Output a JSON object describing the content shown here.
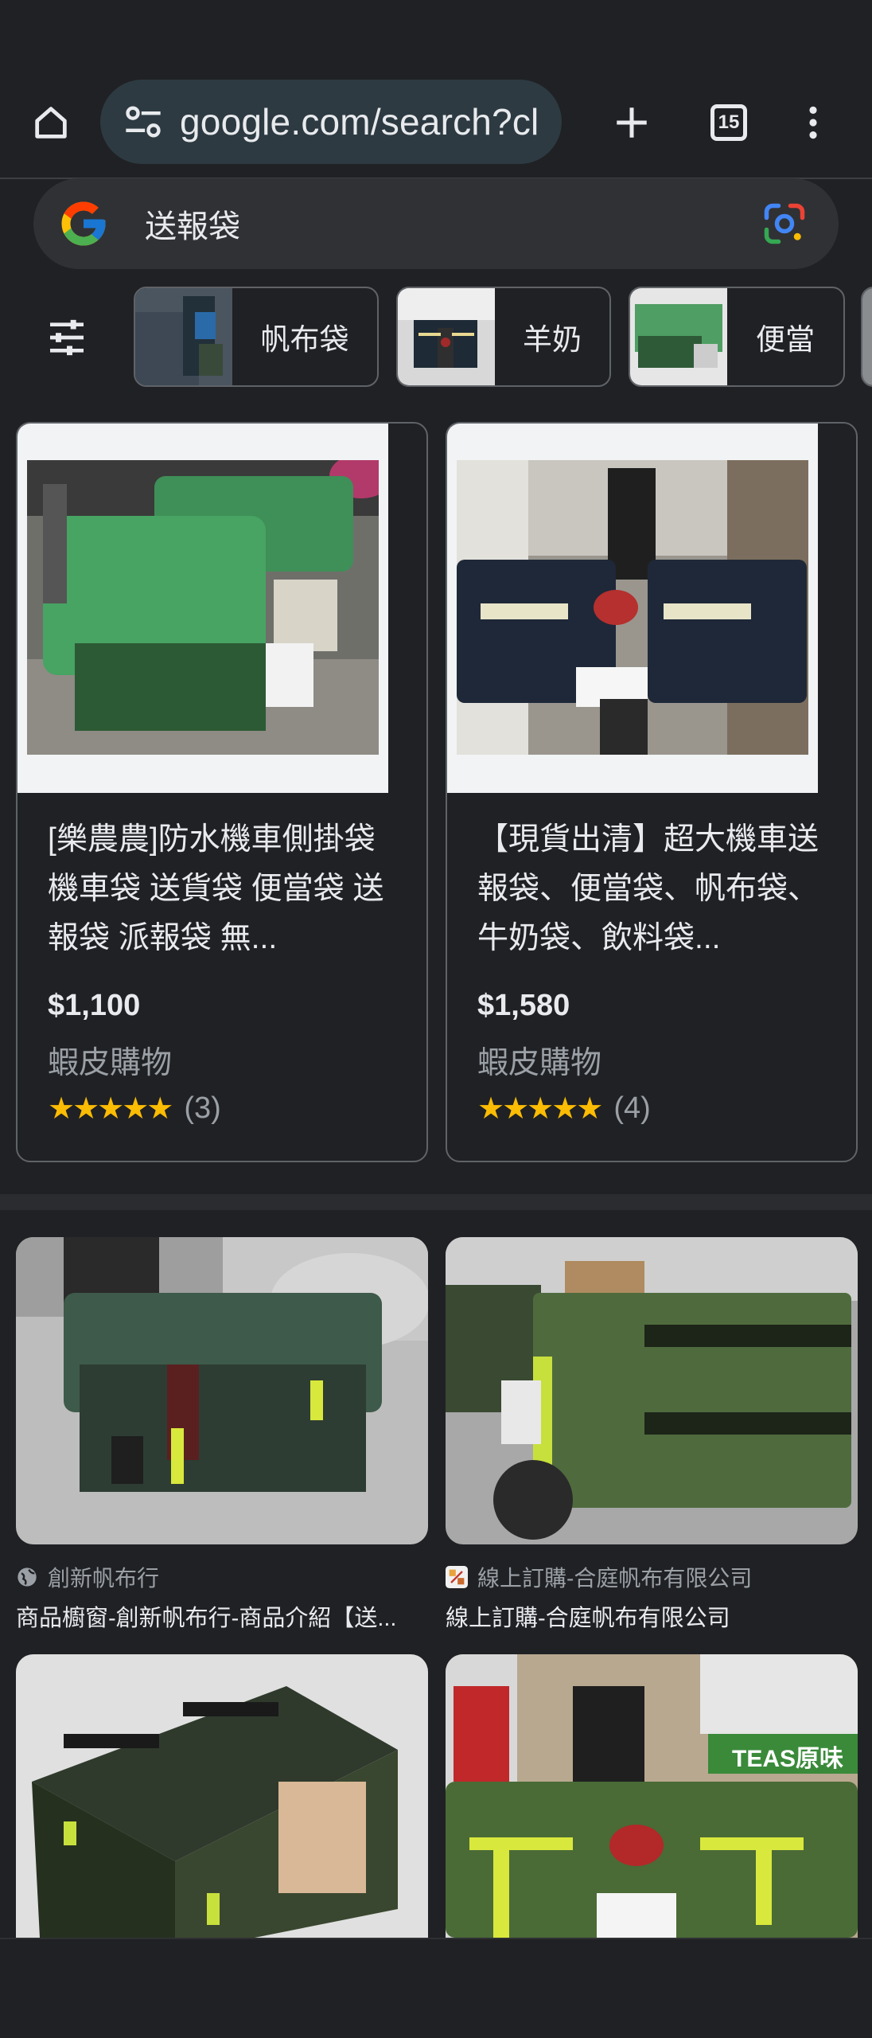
{
  "browser": {
    "url": "google.com/search?cl",
    "tab_count": "15",
    "icons": {
      "home": "home-icon",
      "site_info": "tune-icon",
      "new_tab": "plus-icon",
      "tabs": "tab-switcher-icon",
      "menu": "more-vert-icon"
    }
  },
  "search": {
    "query": "送報袋",
    "lens_icon": "google-lens-icon"
  },
  "filters": {
    "icon": "tune-filters-icon",
    "chips": [
      {
        "label": "帆布袋"
      },
      {
        "label": "羊奶"
      },
      {
        "label": "便當"
      }
    ]
  },
  "shopping": [
    {
      "title": "[樂農農]防水機車側掛袋 機車袋 送貨袋 便當袋 送報袋 派報袋 無...",
      "price": "$1,100",
      "merchant": "蝦皮購物",
      "stars": "★★★★★",
      "rating_value": 5,
      "reviews": "(3)"
    },
    {
      "title": "【現貨出清】超大機車送報袋、便當袋、帆布袋、牛奶袋、飲料袋...",
      "price": "$1,580",
      "merchant": "蝦皮購物",
      "stars": "★★★★★",
      "rating_value": 5,
      "reviews": "(4)"
    }
  ],
  "images": [
    {
      "source": "創新帆布行",
      "caption": "商品櫥窗-創新帆布行-商品介紹【送...",
      "favicon": "globe-icon"
    },
    {
      "source": "線上訂購-合庭帆布有限公司",
      "caption": "線上訂購-合庭帆布有限公司",
      "favicon": "site-favicon"
    },
    {
      "source": "",
      "caption": ""
    },
    {
      "source": "",
      "caption": "",
      "sign_text": "TEAS原味"
    }
  ],
  "colors": {
    "background": "#202124",
    "surface": "#303134",
    "omnibox": "#2d3a42",
    "text": "#e8eaed",
    "muted": "#9aa0a6",
    "star": "#fbbc04",
    "border": "#5f6368"
  }
}
